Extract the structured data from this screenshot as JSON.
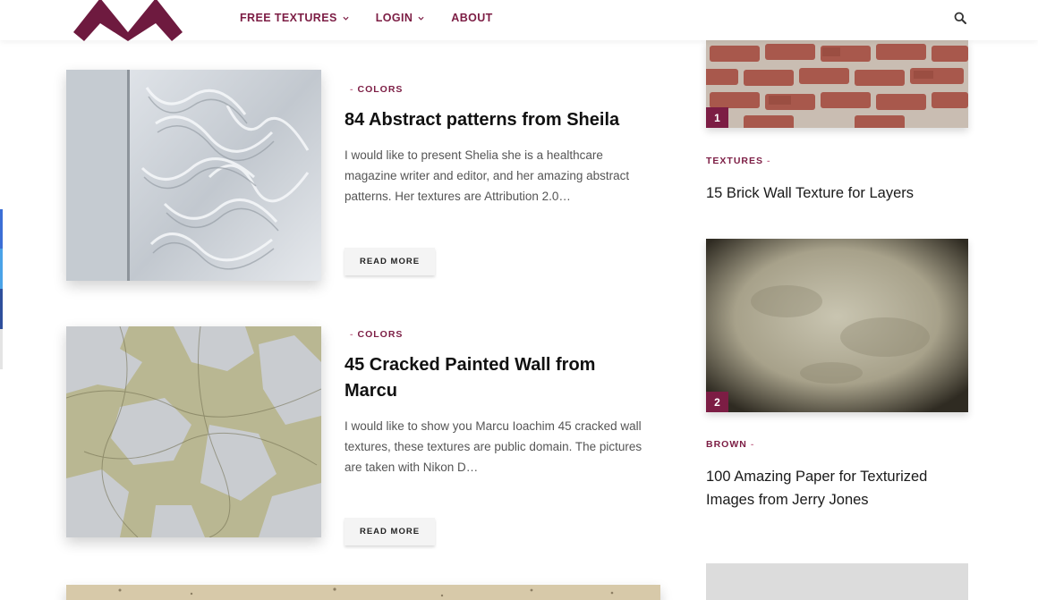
{
  "header": {
    "nav": [
      {
        "label": "FREE TEXTURES",
        "has_dropdown": true
      },
      {
        "label": "LOGIN",
        "has_dropdown": true
      },
      {
        "label": "ABOUT",
        "has_dropdown": false
      }
    ],
    "search_icon": "search-icon"
  },
  "colors": {
    "accent": "#7c1d44",
    "button_bg": "#f4f4f4"
  },
  "posts": [
    {
      "category": "COLORS",
      "title": "84 Abstract patterns from Sheila",
      "excerpt": "I would like to present Shelia she is a healthcare magazine writer and editor, and her amazing abstract patterns. Her textures are Attribution 2.0…",
      "read_more": "READ MORE"
    },
    {
      "category": "COLORS",
      "title": "45 Cracked Painted Wall from Marcu",
      "excerpt": "I would like to show you Marcu Ioachim 45 cracked wall textures, these textures are public domain. The pictures are taken with Nikon D…",
      "read_more": "READ MORE"
    }
  ],
  "sidebar": {
    "items": [
      {
        "rank": "1",
        "category": "TEXTURES",
        "title": "15 Brick Wall Texture for Layers"
      },
      {
        "rank": "2",
        "category": "BROWN",
        "title": "100 Amazing Paper for Texturized Images from Jerry Jones"
      }
    ]
  }
}
